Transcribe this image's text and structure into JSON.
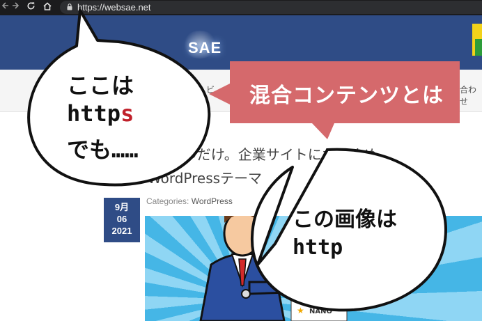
{
  "browser": {
    "back_icon": "arrow-left-icon",
    "forward_icon": "arrow-right-icon",
    "reload_icon": "reload-icon",
    "home_icon": "home-icon",
    "lock_icon": "lock-icon",
    "url": "https://websae.net"
  },
  "site": {
    "logo_text": "SAE",
    "nav_left_fragment": "ビ",
    "nav_right_fragment": "合わせ"
  },
  "article": {
    "title_line1": "6つだけ。企業サイトにおすすめ",
    "title_line2": "WordPressテーマ",
    "date_month": "9月",
    "date_day": "06",
    "date_year": "2021",
    "categories_label": "Categories:",
    "category": "WordPress",
    "thumb_text": "NANO"
  },
  "annotations": {
    "bubble1_line1": "ここは",
    "bubble1_line2_prefix": "http",
    "bubble1_line2_highlight": "s",
    "bubble1_line3": "でも……",
    "banner": "混合コンテンツとは",
    "bubble2_line1": "この画像は",
    "bubble2_line2": "http",
    "highlight_color": "#c0202a",
    "banner_color": "#d5696c"
  }
}
